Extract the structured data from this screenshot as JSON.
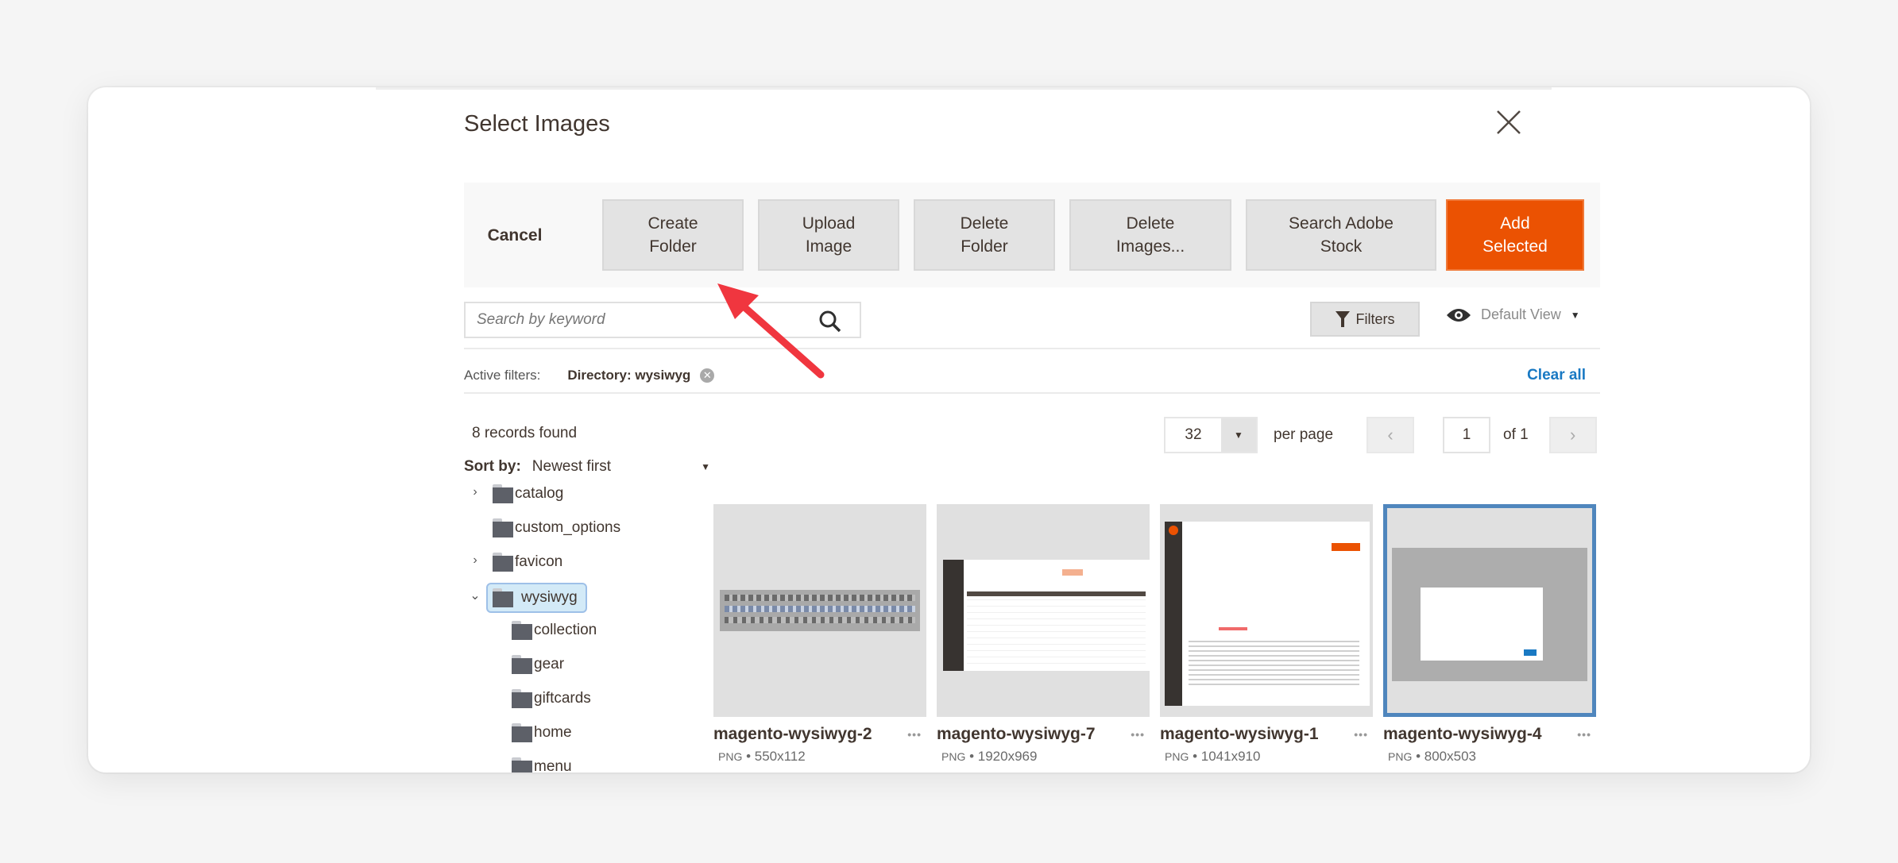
{
  "modal": {
    "title": "Select Images",
    "close_icon": "close-icon"
  },
  "toolbar": {
    "cancel": "Cancel",
    "create_folder": "Create\nFolder",
    "upload_image": "Upload\nImage",
    "delete_folder": "Delete\nFolder",
    "delete_images": "Delete\nImages...",
    "search_adobe_stock": "Search Adobe\nStock",
    "add_selected": "Add\nSelected"
  },
  "colors": {
    "primary": "#eb5202",
    "link": "#1979c3",
    "selected_border": "#4f86bd",
    "annotation_arrow": "#f0363f"
  },
  "search": {
    "placeholder": "Search by keyword",
    "value": "",
    "icon": "search-icon"
  },
  "filters": {
    "button_label": "Filters",
    "view_label": "Default View",
    "active_label": "Active filters:",
    "active_chip": "Directory: wysiwyg",
    "clear_all": "Clear all"
  },
  "listing": {
    "records_found": "8 records found",
    "sort_label": "Sort by:",
    "sort_value": "Newest first",
    "per_page_value": "32",
    "per_page_label": "per page",
    "current_page": "1",
    "page_total": "of 1",
    "prev": "‹",
    "next": "›"
  },
  "tree": [
    {
      "label": "catalog",
      "level": 0,
      "toggle": "›",
      "selected": false
    },
    {
      "label": "custom_options",
      "level": 0,
      "toggle": "",
      "selected": false
    },
    {
      "label": "favicon",
      "level": 0,
      "toggle": "›",
      "selected": false
    },
    {
      "label": "wysiwyg",
      "level": 0,
      "toggle": "⌄",
      "selected": true
    },
    {
      "label": "collection",
      "level": 1,
      "toggle": "",
      "selected": false
    },
    {
      "label": "gear",
      "level": 1,
      "toggle": "",
      "selected": false
    },
    {
      "label": "giftcards",
      "level": 1,
      "toggle": "",
      "selected": false
    },
    {
      "label": "home",
      "level": 1,
      "toggle": "",
      "selected": false
    },
    {
      "label": "menu",
      "level": 1,
      "toggle": "",
      "selected": false
    }
  ],
  "images": [
    {
      "name": "magento-wysiwyg-2",
      "format": "PNG",
      "dimensions": "550x112",
      "selected": false
    },
    {
      "name": "magento-wysiwyg-7",
      "format": "PNG",
      "dimensions": "1920x969",
      "selected": false
    },
    {
      "name": "magento-wysiwyg-1",
      "format": "PNG",
      "dimensions": "1041x910",
      "selected": false
    },
    {
      "name": "magento-wysiwyg-4",
      "format": "PNG",
      "dimensions": "800x503",
      "selected": true
    }
  ],
  "meta_separator": "•",
  "more_icon": "•••"
}
